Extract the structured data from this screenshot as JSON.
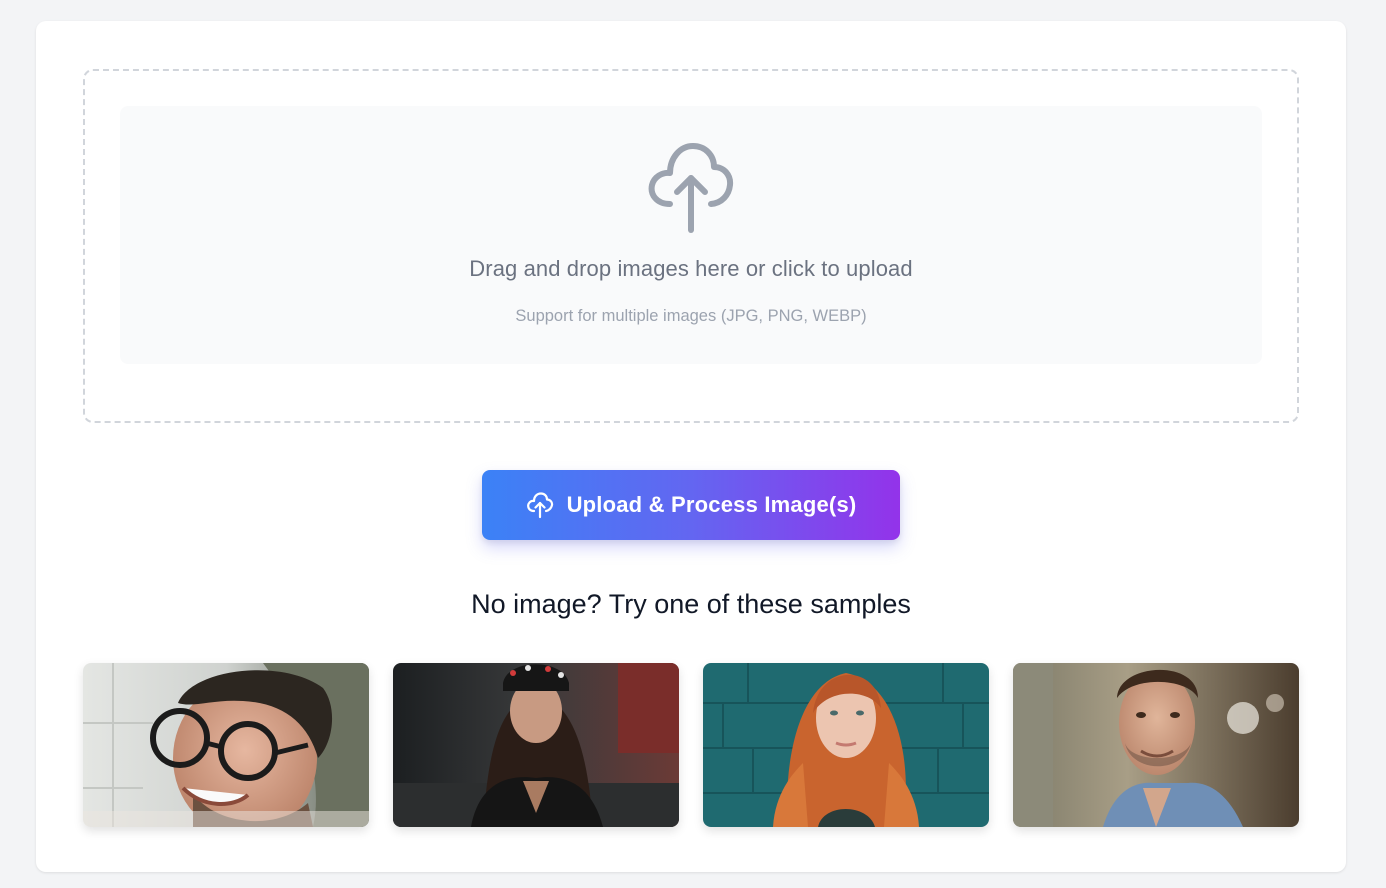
{
  "dropzone": {
    "icon": "cloud-upload-icon",
    "title": "Drag and drop images here or click to upload",
    "subtitle": "Support for multiple images (JPG, PNG, WEBP)"
  },
  "upload_button": {
    "icon": "cloud-upload-icon",
    "label": "Upload & Process Image(s)"
  },
  "samples": {
    "heading": "No image? Try one of these samples",
    "items": [
      {
        "id": "sample-1"
      },
      {
        "id": "sample-2"
      },
      {
        "id": "sample-3"
      },
      {
        "id": "sample-4"
      }
    ]
  },
  "colors": {
    "gradient_start": "#3b82f6",
    "gradient_end": "#9333ea",
    "page_bg": "#f3f4f6",
    "dropzone_border": "#d1d5db"
  }
}
